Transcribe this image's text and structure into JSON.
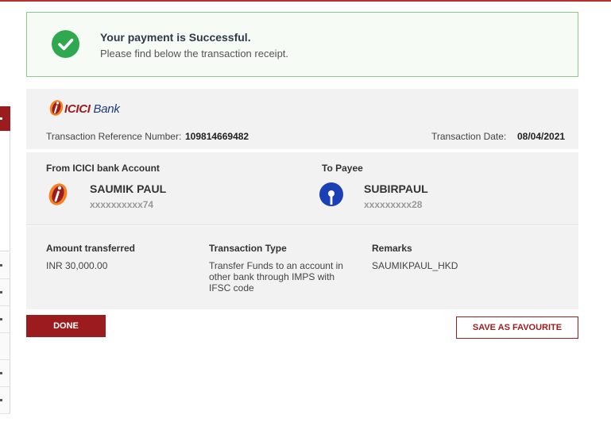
{
  "status": {
    "title": "Your payment is Successful.",
    "subtitle": "Please find below the transaction receipt.",
    "icon": "check-circle-icon",
    "color": "#2fa84f"
  },
  "bank": {
    "logo_text": "ICICI",
    "logo_text2": " Bank",
    "brand_color": "#9c1b1e"
  },
  "transaction": {
    "ref_label": "Transaction Reference Number:",
    "ref_value": "109814669482",
    "date_label": "Transaction Date:",
    "date_value": "08/04/2021"
  },
  "from_account": {
    "heading": "From ICICI bank Account",
    "name": "SAUMIK PAUL",
    "number": "xxxxxxxxxx74",
    "icon": "icici-logo-icon"
  },
  "to_payee": {
    "heading": "To Payee",
    "name": "SUBIRPAUL",
    "number": "xxxxxxxxx28",
    "icon": "sbi-logo-icon"
  },
  "details": {
    "amount_label": "Amount transferred",
    "amount_value": "INR 30,000.00",
    "type_label": "Transaction Type",
    "type_value": "Transfer Funds to an account in other bank through IMPS with IFSC code",
    "remarks_label": "Remarks",
    "remarks_value": "SAUMIKPAUL_HKD"
  },
  "actions": {
    "done_label": "DONE",
    "favourite_label": "SAVE AS FAVOURITE"
  }
}
